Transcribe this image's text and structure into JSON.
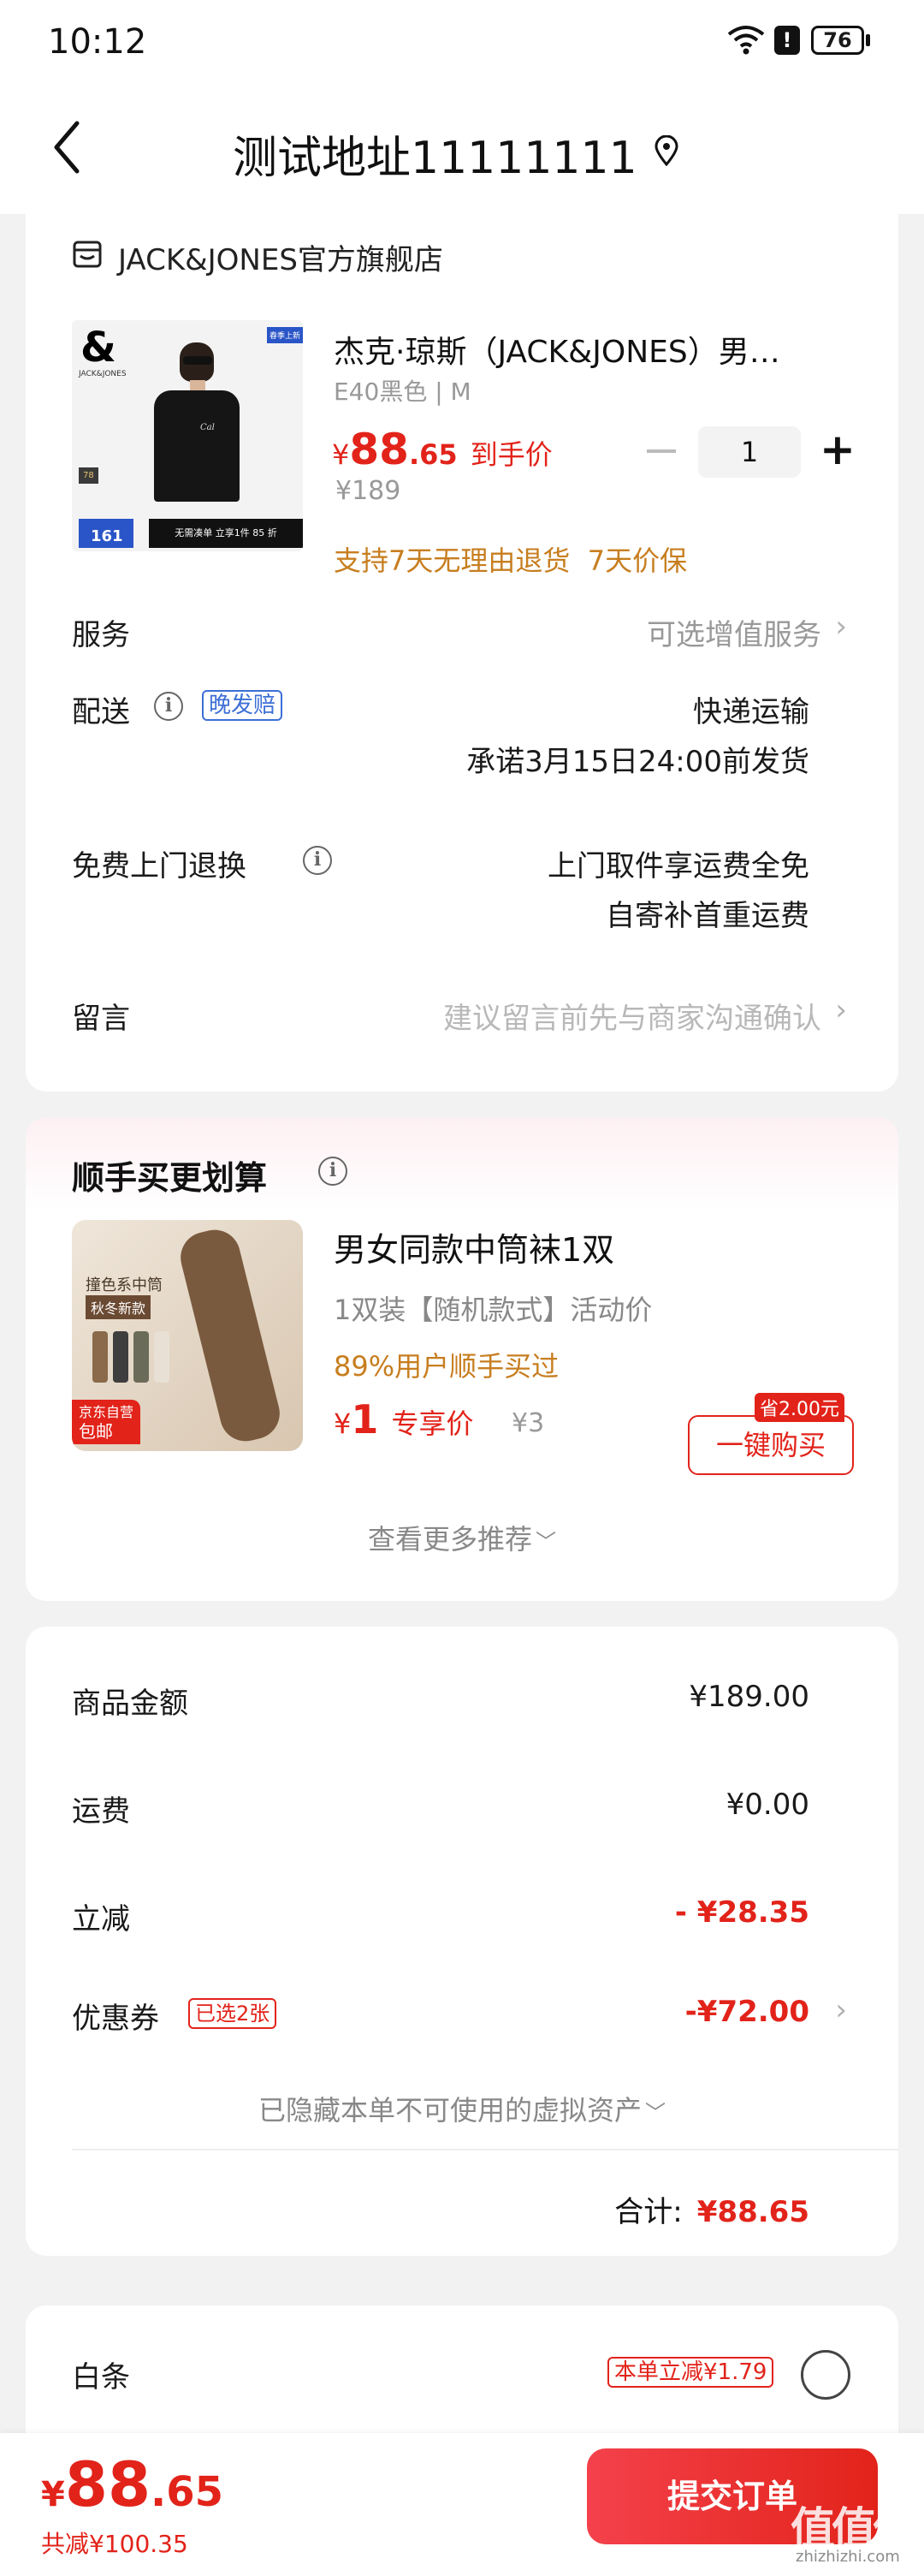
{
  "status_bar": {
    "time": "10:12",
    "battery": "76"
  },
  "header": {
    "title": "测试地址11111111"
  },
  "shop": {
    "name": "JACK&JONES官方旗舰店"
  },
  "product": {
    "title": "杰克·琼斯（JACK&JONES）男…",
    "spec": "E40黑色 | M",
    "price_symbol": "¥",
    "price_int": "88",
    "price_dec": ".65",
    "price_label": "到手价",
    "original_price": "¥189",
    "quantity": "1",
    "promises": "支持7天无理由退货  7天价保",
    "image": {
      "logo": "&",
      "brand_small": "JACK&JONES",
      "badge": "春季上新",
      "num_label": "161",
      "num_badge": "78",
      "banner": "无需凑单 立享1件 85 折"
    }
  },
  "rows": {
    "service_label": "服务",
    "service_value": "可选增值服务",
    "delivery_label": "配送",
    "delivery_tag": "晚发赔",
    "delivery_value1": "快递运输",
    "delivery_value2": "承诺3月15日24:00前发货",
    "return_label": "免费上门退换",
    "return_value1": "上门取件享运费全免",
    "return_value2": "自寄补首重运费",
    "message_label": "留言",
    "message_placeholder": "建议留言前先与商家沟通确认"
  },
  "addon": {
    "section_title": "顺手买更划算",
    "title": "男女同款中筒袜1双",
    "spec": "1双装【随机款式】活动价",
    "stat": "89%用户顺手买过",
    "price_symbol": "¥",
    "price": "1",
    "price_label": "专享价",
    "original": "¥3",
    "save_badge": "省2.00元",
    "buy_button": "一键购买",
    "image_text1": "撞色系中筒",
    "image_text2": "秋冬新款",
    "image_tag1": "京东自营",
    "image_tag2": "包邮",
    "more": "查看更多推荐"
  },
  "summary": {
    "goods_label": "商品金额",
    "goods_value": "¥189.00",
    "shipping_label": "运费",
    "shipping_value": "¥0.00",
    "discount_label": "立减",
    "discount_value": "- ¥28.35",
    "coupon_label": "优惠券",
    "coupon_tag": "已选2张",
    "coupon_value": "-¥72.00",
    "hidden_note": "已隐藏本单不可使用的虚拟资产",
    "total_label": "合计:",
    "total_value": "¥88.65"
  },
  "payment": {
    "baitiao_label": "白条",
    "baitiao_tag": "本单立减¥1.79"
  },
  "bottom": {
    "price_symbol": "¥",
    "price_int": "88",
    "price_dec": ".65",
    "saved": "共减¥100.35",
    "submit": "提交订单",
    "watermark": "值值值",
    "watermark_url": "zhizhizhi.com"
  }
}
